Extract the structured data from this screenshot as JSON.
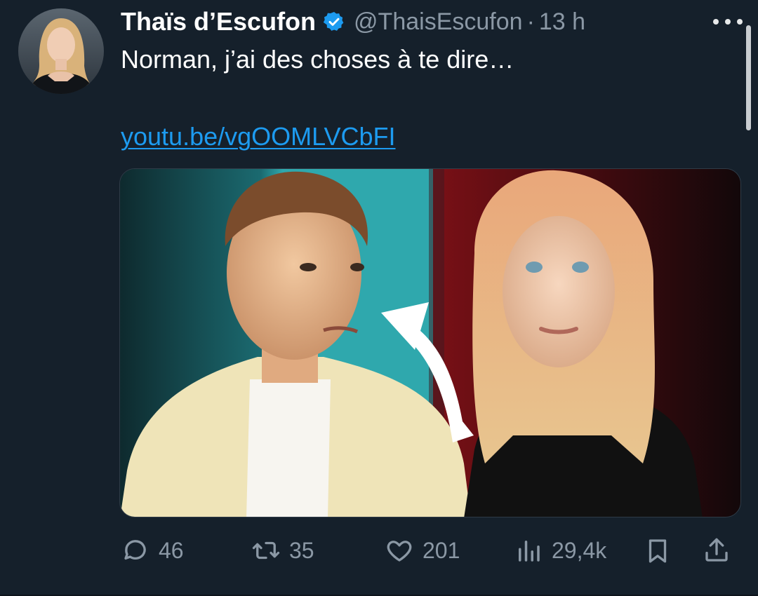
{
  "tweet": {
    "author": {
      "display_name": "Thaïs d’Escufon",
      "handle": "@ThaisEscufon",
      "separator": "·",
      "time": "13 h",
      "verified": true
    },
    "text": "Norman, j’ai des choses à te dire…",
    "link_text": "youtu.be/vgOOMLVCbFI",
    "media": {
      "type": "video-thumbnail"
    },
    "actions": {
      "replies": "46",
      "retweets": "35",
      "likes": "201",
      "views": "29,4k"
    }
  },
  "icons": {
    "verified": "verified-badge-icon",
    "more": "more-dots-icon",
    "reply": "reply-bubble-icon",
    "retweet": "retweet-icon",
    "like": "heart-icon",
    "views": "bar-chart-icon",
    "bookmark": "bookmark-icon",
    "share": "share-upload-icon"
  },
  "colors": {
    "background": "#15202b",
    "text_primary": "#ffffff",
    "text_secondary": "#8b98a5",
    "link": "#1d9bf0",
    "verified_badge": "#1d9bf0"
  }
}
